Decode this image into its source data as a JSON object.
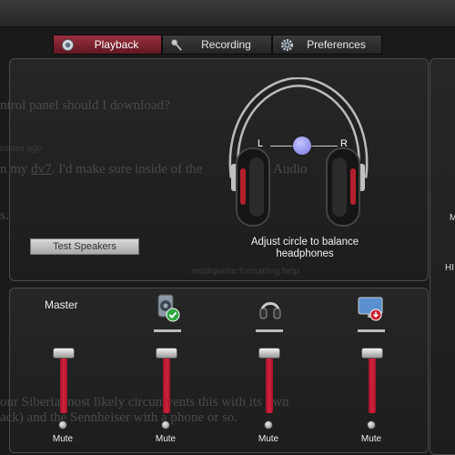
{
  "tabs": [
    {
      "label": "Playback",
      "icon": "speaker-cone-icon",
      "active": true
    },
    {
      "label": "Recording",
      "icon": "microphone-icon",
      "active": false
    },
    {
      "label": "Preferences",
      "icon": "gear-icon",
      "active": false
    }
  ],
  "background_text": {
    "line1": "ntrol panel should I download?",
    "line2": "inutes ago",
    "line3a": "n my ",
    "line3b": "dv7",
    "line3c": ". I'd make sure inside of the",
    "line3d": "Audio",
    "line4": "s.",
    "footer": "reddiquette   formatting help",
    "bottom1": "our Siberia most likely circumvents this with its own",
    "bottom2": "ack) and the Sennheiser with a phone or so."
  },
  "test_button": "Test Speakers",
  "balance": {
    "left_label": "L",
    "right_label": "R",
    "position": 0.5
  },
  "caption": "Adjust circle to balance headphones",
  "side_labels": {
    "a": "M",
    "b": "HI"
  },
  "mixer": {
    "master_label": "Master",
    "mute_label": "Mute",
    "channels": [
      {
        "name": "master",
        "icon": "",
        "level": 1.0
      },
      {
        "name": "speakers",
        "icon": "speaker-check-icon",
        "level": 1.0
      },
      {
        "name": "headphones",
        "icon": "headphones-icon",
        "level": 1.0
      },
      {
        "name": "monitor",
        "icon": "monitor-audio-icon",
        "level": 1.0
      }
    ]
  },
  "colors": {
    "accent": "#c8213a",
    "tab_active": "#8a2633",
    "balance_knob": "#8c8ae8"
  }
}
